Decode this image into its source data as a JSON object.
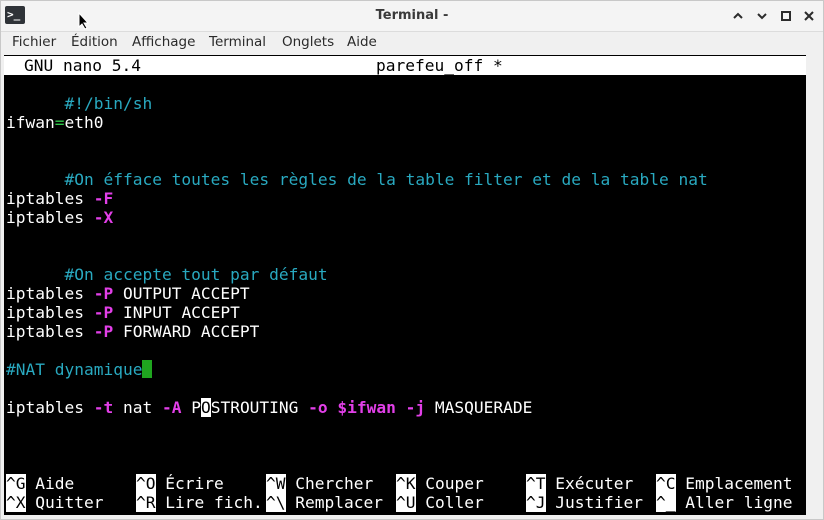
{
  "window": {
    "title": "Terminal -",
    "app_icon_glyph": ">_",
    "wm_buttons": [
      "minimize",
      "maximize",
      "restore",
      "close"
    ]
  },
  "menu": {
    "items": [
      "Fichier",
      "Édition",
      "Affichage",
      "Terminal",
      "Onglets",
      "Aide"
    ]
  },
  "nano": {
    "version": "GNU nano 5.4",
    "filename": "parefeu_off *"
  },
  "code": {
    "shebang": "#!/bin/sh",
    "ifwan_name": "ifwan",
    "ifwan_eq": "=",
    "ifwan_value": "eth0",
    "comment_flush": "#On éfface toutes les règles de la table filter et de la table nat",
    "cmd": "iptables ",
    "flag_F": "-F",
    "flag_X": "-X",
    "comment_accept": "#On accepte tout par défaut",
    "flag_P": "-P",
    "policy_output": " OUTPUT ACCEPT",
    "policy_input": " INPUT ACCEPT",
    "policy_forward": " FORWARD ACCEPT",
    "comment_nat": "#NAT dynamique",
    "flag_t": "-t",
    "nat_table": " nat ",
    "flag_A": "-A",
    "chain_prefix": " P",
    "chain_cursor": "O",
    "chain_rest": "STROUTING ",
    "flag_o": "-o",
    "var_ifwan": "$ifwan",
    "flag_j": "-j",
    "target": " MASQUERADE"
  },
  "shortcuts": {
    "row1": [
      {
        "key": "^G",
        "label": " Aide"
      },
      {
        "key": "^O",
        "label": " Écrire"
      },
      {
        "key": "^W",
        "label": " Chercher"
      },
      {
        "key": "^K",
        "label": " Couper"
      },
      {
        "key": "^T",
        "label": " Exécuter"
      },
      {
        "key": "^C",
        "label": " Emplacement"
      }
    ],
    "row2": [
      {
        "key": "^X",
        "label": " Quitter"
      },
      {
        "key": "^R",
        "label": " Lire fich."
      },
      {
        "key": "^\\",
        "label": " Remplacer"
      },
      {
        "key": "^U",
        "label": " Coller"
      },
      {
        "key": "^J",
        "label": " Justifier"
      },
      {
        "key": "^_",
        "label": " Aller ligne"
      }
    ]
  },
  "colors": {
    "terminal_bg": "#000000",
    "comment": "#29a9c0",
    "flag": "#e23fe8",
    "cursor": "#1fa51f"
  }
}
